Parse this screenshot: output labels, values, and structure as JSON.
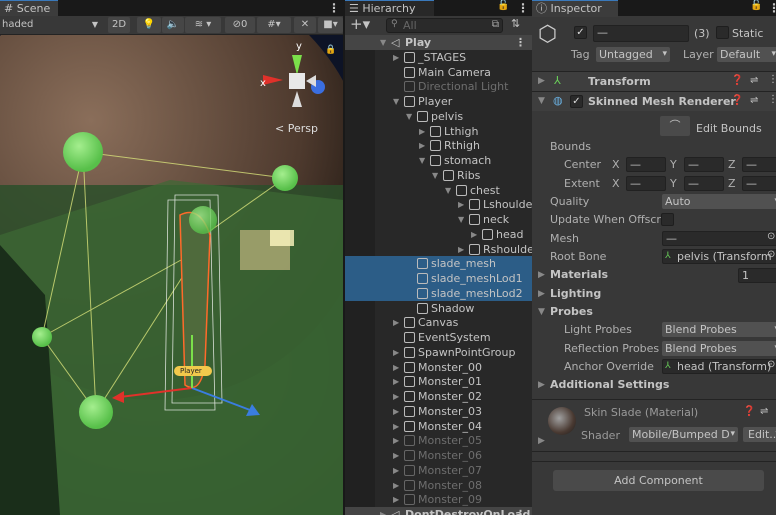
{
  "scene": {
    "tab": "Scene",
    "shading": "haded",
    "btn_2d": "2D",
    "hidden_count": "0",
    "persp_label": "< Persp",
    "axis_x": "x",
    "axis_y": "y",
    "player_tag": "Player"
  },
  "hierarchy": {
    "tab": "Hierarchy",
    "search_placeholder": "All",
    "rows": [
      {
        "label": "Play",
        "level": 0,
        "arrow": "down",
        "scene": true
      },
      {
        "label": "_STAGES",
        "level": 1,
        "arrow": "right"
      },
      {
        "label": "Main Camera",
        "level": 1,
        "arrow": ""
      },
      {
        "label": "Directional Light",
        "level": 1,
        "arrow": "",
        "dim": true
      },
      {
        "label": "Player",
        "level": 1,
        "arrow": "down"
      },
      {
        "label": "pelvis",
        "level": 2,
        "arrow": "down"
      },
      {
        "label": "Lthigh",
        "level": 3,
        "arrow": "right"
      },
      {
        "label": "Rthigh",
        "level": 3,
        "arrow": "right"
      },
      {
        "label": "stomach",
        "level": 3,
        "arrow": "down"
      },
      {
        "label": "Ribs",
        "level": 4,
        "arrow": "down"
      },
      {
        "label": "chest",
        "level": 5,
        "arrow": "down"
      },
      {
        "label": "Lshoulde",
        "level": 6,
        "arrow": "right"
      },
      {
        "label": "neck",
        "level": 6,
        "arrow": "down"
      },
      {
        "label": "head",
        "level": 7,
        "arrow": "right"
      },
      {
        "label": "Rshoulde",
        "level": 6,
        "arrow": "right"
      },
      {
        "label": "slade_mesh",
        "level": 2,
        "arrow": "",
        "selected": true
      },
      {
        "label": "slade_meshLod1",
        "level": 2,
        "arrow": "",
        "selected": true
      },
      {
        "label": "slade_meshLod2",
        "level": 2,
        "arrow": "",
        "selected": true
      },
      {
        "label": "Shadow",
        "level": 2,
        "arrow": ""
      },
      {
        "label": "Canvas",
        "level": 1,
        "arrow": "right"
      },
      {
        "label": "EventSystem",
        "level": 1,
        "arrow": ""
      },
      {
        "label": "SpawnPointGroup",
        "level": 1,
        "arrow": "right"
      },
      {
        "label": "Monster_00",
        "level": 1,
        "arrow": "right"
      },
      {
        "label": "Monster_01",
        "level": 1,
        "arrow": "right"
      },
      {
        "label": "Monster_02",
        "level": 1,
        "arrow": "right"
      },
      {
        "label": "Monster_03",
        "level": 1,
        "arrow": "right"
      },
      {
        "label": "Monster_04",
        "level": 1,
        "arrow": "right"
      },
      {
        "label": "Monster_05",
        "level": 1,
        "arrow": "right",
        "dim": true
      },
      {
        "label": "Monster_06",
        "level": 1,
        "arrow": "right",
        "dim": true
      },
      {
        "label": "Monster_07",
        "level": 1,
        "arrow": "right",
        "dim": true
      },
      {
        "label": "Monster_08",
        "level": 1,
        "arrow": "right",
        "dim": true
      },
      {
        "label": "Monster_09",
        "level": 1,
        "arrow": "right",
        "dim": true
      },
      {
        "label": "DontDestroyOnLoad",
        "level": 0,
        "arrow": "right",
        "scene": true
      }
    ]
  },
  "inspector": {
    "tab": "Inspector",
    "name_value": "—",
    "count": "(3)",
    "static_label": "Static",
    "tag_label": "Tag",
    "tag_value": "Untagged",
    "layer_label": "Layer",
    "layer_value": "Default",
    "transform": "Transform",
    "smr": "Skinned Mesh Renderer",
    "edit_bounds": "Edit Bounds",
    "bounds": "Bounds",
    "center": "Center",
    "extent": "Extent",
    "x": "X",
    "y": "Y",
    "z": "Z",
    "mixed": "—",
    "quality_label": "Quality",
    "quality_value": "Auto",
    "update_offscreen": "Update When Offscre",
    "mesh_label": "Mesh",
    "mesh_value": "—",
    "root_bone_label": "Root Bone",
    "root_bone_value": "pelvis (Transform",
    "materials": "Materials",
    "materials_count": "1",
    "lighting": "Lighting",
    "probes": "Probes",
    "light_probes_label": "Light Probes",
    "light_probes_value": "Blend Probes",
    "reflection_probes_label": "Reflection Probes",
    "reflection_probes_value": "Blend Probes",
    "anchor_label": "Anchor Override",
    "anchor_value": "head (Transform)",
    "additional": "Additional Settings",
    "material_name": "Skin Slade (Material)",
    "shader_label": "Shader",
    "shader_value": "Mobile/Bumped D",
    "edit_btn": "Edit...",
    "add_component": "Add Component"
  },
  "colors": {
    "selection": "#2c5d87",
    "accent": "#3a79bb"
  }
}
